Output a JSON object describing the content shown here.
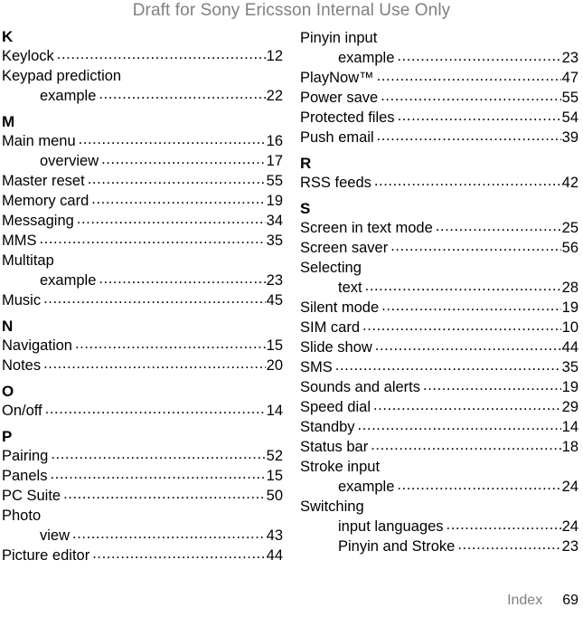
{
  "header": {
    "draft_notice": "Draft for Sony Ericsson Internal Use Only"
  },
  "footer": {
    "label": "Index",
    "page_number": "69"
  },
  "colors": {
    "text": "#000000",
    "muted": "#808080",
    "background": "#ffffff"
  },
  "columns": {
    "left": {
      "sections": [
        {
          "letter": "K",
          "entries": [
            {
              "label": "Keylock",
              "page": "12",
              "sub": false,
              "has_page": true
            },
            {
              "label": "Keypad prediction",
              "page": "",
              "sub": false,
              "has_page": false
            },
            {
              "label": "example",
              "page": "22",
              "sub": true,
              "has_page": true
            }
          ]
        },
        {
          "letter": "M",
          "entries": [
            {
              "label": "Main menu",
              "page": "16",
              "sub": false,
              "has_page": true
            },
            {
              "label": "overview",
              "page": "17",
              "sub": true,
              "has_page": true
            },
            {
              "label": "Master reset",
              "page": "55",
              "sub": false,
              "has_page": true
            },
            {
              "label": "Memory card",
              "page": "19",
              "sub": false,
              "has_page": true
            },
            {
              "label": "Messaging",
              "page": "34",
              "sub": false,
              "has_page": true
            },
            {
              "label": "MMS",
              "page": "35",
              "sub": false,
              "has_page": true
            },
            {
              "label": "Multitap",
              "page": "",
              "sub": false,
              "has_page": false
            },
            {
              "label": "example",
              "page": "23",
              "sub": true,
              "has_page": true
            },
            {
              "label": "Music",
              "page": "45",
              "sub": false,
              "has_page": true
            }
          ]
        },
        {
          "letter": "N",
          "entries": [
            {
              "label": "Navigation",
              "page": "15",
              "sub": false,
              "has_page": true
            },
            {
              "label": "Notes",
              "page": "20",
              "sub": false,
              "has_page": true
            }
          ]
        },
        {
          "letter": "O",
          "entries": [
            {
              "label": "On/off",
              "page": "14",
              "sub": false,
              "has_page": true
            }
          ]
        },
        {
          "letter": "P",
          "entries": [
            {
              "label": "Pairing",
              "page": "52",
              "sub": false,
              "has_page": true
            },
            {
              "label": "Panels",
              "page": "15",
              "sub": false,
              "has_page": true
            },
            {
              "label": "PC Suite",
              "page": "50",
              "sub": false,
              "has_page": true
            },
            {
              "label": "Photo",
              "page": "",
              "sub": false,
              "has_page": false
            },
            {
              "label": "view",
              "page": "43",
              "sub": true,
              "has_page": true
            },
            {
              "label": "Picture editor",
              "page": "44",
              "sub": false,
              "has_page": true
            }
          ]
        }
      ]
    },
    "right": {
      "sections": [
        {
          "letter": "",
          "entries": [
            {
              "label": "Pinyin input",
              "page": "",
              "sub": false,
              "has_page": false
            },
            {
              "label": "example",
              "page": "23",
              "sub": true,
              "has_page": true
            },
            {
              "label": "PlayNow™",
              "page": "47",
              "sub": false,
              "has_page": true
            },
            {
              "label": "Power save",
              "page": "55",
              "sub": false,
              "has_page": true
            },
            {
              "label": "Protected files",
              "page": "54",
              "sub": false,
              "has_page": true
            },
            {
              "label": "Push email",
              "page": "39",
              "sub": false,
              "has_page": true
            }
          ]
        },
        {
          "letter": "R",
          "entries": [
            {
              "label": "RSS feeds",
              "page": "42",
              "sub": false,
              "has_page": true
            }
          ]
        },
        {
          "letter": "S",
          "entries": [
            {
              "label": "Screen in text mode",
              "page": "25",
              "sub": false,
              "has_page": true
            },
            {
              "label": "Screen saver",
              "page": "56",
              "sub": false,
              "has_page": true
            },
            {
              "label": "Selecting",
              "page": "",
              "sub": false,
              "has_page": false
            },
            {
              "label": "text",
              "page": "28",
              "sub": true,
              "has_page": true
            },
            {
              "label": "Silent mode",
              "page": "19",
              "sub": false,
              "has_page": true
            },
            {
              "label": "SIM card",
              "page": "10",
              "sub": false,
              "has_page": true
            },
            {
              "label": "Slide show",
              "page": "44",
              "sub": false,
              "has_page": true
            },
            {
              "label": "SMS",
              "page": "35",
              "sub": false,
              "has_page": true
            },
            {
              "label": "Sounds and alerts",
              "page": "19",
              "sub": false,
              "has_page": true
            },
            {
              "label": "Speed dial",
              "page": "29",
              "sub": false,
              "has_page": true
            },
            {
              "label": "Standby",
              "page": "14",
              "sub": false,
              "has_page": true
            },
            {
              "label": "Status bar",
              "page": "18",
              "sub": false,
              "has_page": true
            },
            {
              "label": "Stroke input",
              "page": "",
              "sub": false,
              "has_page": false
            },
            {
              "label": "example",
              "page": "24",
              "sub": true,
              "has_page": true
            },
            {
              "label": "Switching",
              "page": "",
              "sub": false,
              "has_page": false
            },
            {
              "label": "input languages",
              "page": "24",
              "sub": true,
              "has_page": true
            },
            {
              "label": "Pinyin and Stroke",
              "page": "23",
              "sub": true,
              "has_page": true
            }
          ]
        }
      ]
    }
  }
}
